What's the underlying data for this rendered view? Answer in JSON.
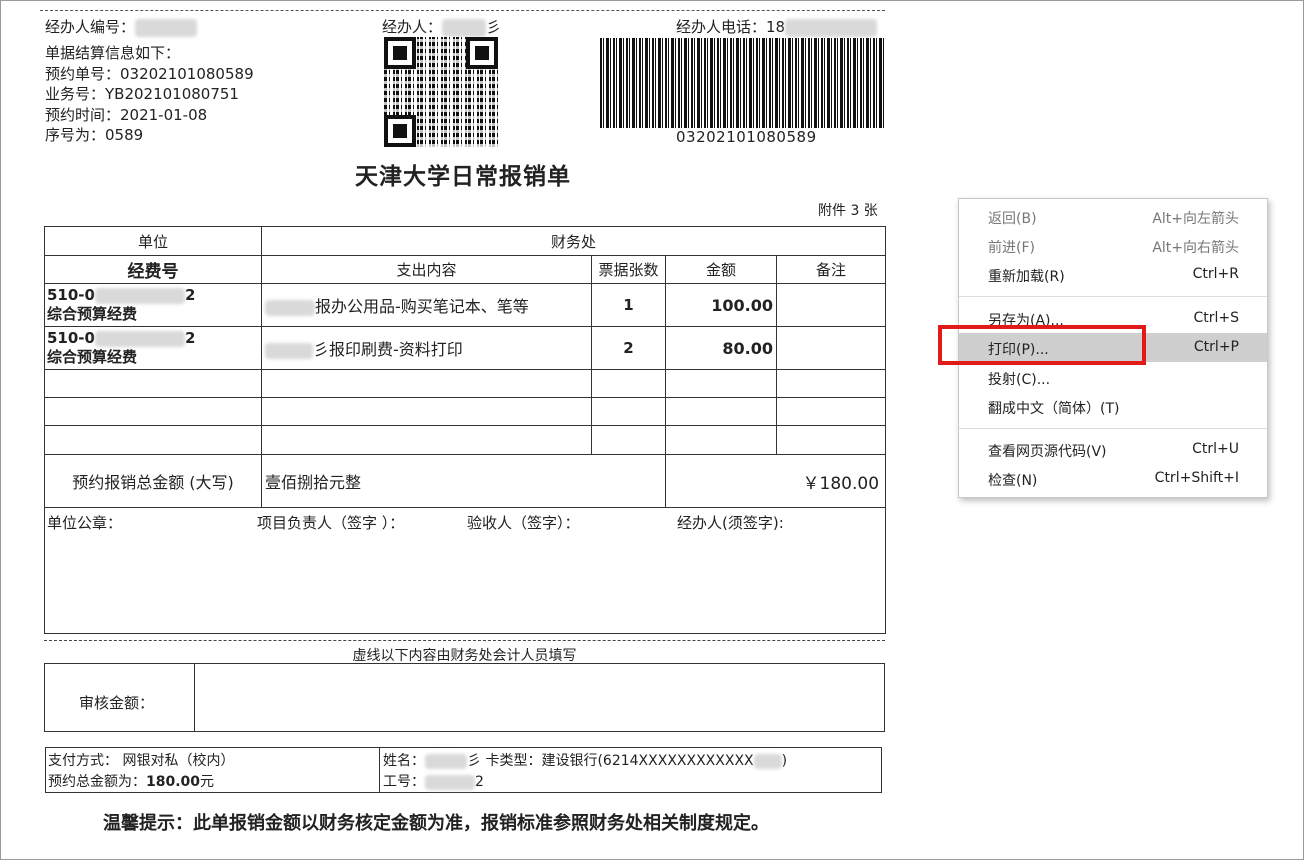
{
  "header": {
    "agent_no_label": "经办人编号：",
    "agent_label": "经办人：",
    "agent_name_suffix": "彡",
    "agent_phone_label": "经办人电话：",
    "agent_phone_prefix": "18"
  },
  "settlement": {
    "intro": "单据结算信息如下：",
    "booking_no": "预约单号：03202101080589",
    "business_no": "业务号：YB202101080751",
    "booking_time": "预约时间：2021-01-08",
    "serial_no": "序号为：0589"
  },
  "barcode_text": "03202101080589",
  "title": "天津大学日常报销单",
  "attachments": "附件 3 张",
  "table": {
    "h_unit": "单位",
    "h_finance": "财务处",
    "h_fund_no": "经费号",
    "h_content": "支出内容",
    "h_count": "票据张数",
    "h_amount": "金额",
    "h_remark": "备注",
    "rows": [
      {
        "fund_prefix": "510-0",
        "fund_suffix": "2",
        "fund_name": "综合预算经费",
        "content": "报办公用品-购买笔记本、笔等",
        "count": "1",
        "amount": "100.00",
        "remark": ""
      },
      {
        "fund_prefix": "510-0",
        "fund_suffix": "2",
        "fund_name": "综合预算经费",
        "content": "彡报印刷费-资料打印",
        "count": "2",
        "amount": "80.00",
        "remark": ""
      }
    ],
    "total_label": "预约报销总金额 (大写)",
    "total_upper": "壹佰捌拾元整",
    "total_amount": "￥180.00",
    "sig_unit_seal": "单位公章：",
    "sig_project_lead": "项目负责人（签字 ）：",
    "sig_acceptor": "验收人（签字）：",
    "sig_agent": "经办人(须签字):"
  },
  "dashed_note": "虚线以下内容由财务处会计人员填写",
  "audit_label": "审核金额：",
  "payment": {
    "method": "支付方式：  网银对私（校内）",
    "total_label": "预约总金额为：",
    "total_value": "180.00",
    "total_unit": "元",
    "name_label": "姓名：",
    "name_suffix": "彡",
    "card_type": " 卡类型：建设银行(6214XXXXXXXXXXXX",
    "card_end": ")",
    "staff_label": "工号：",
    "staff_suffix": "2"
  },
  "tip": "温馨提示：此单报销金额以财务核定金额为准，报销标准参照财务处相关制度规定。",
  "context_menu": {
    "items": [
      {
        "label": "返回(B)",
        "shortcut": "Alt+向左箭头"
      },
      {
        "label": "前进(F)",
        "shortcut": "Alt+向右箭头"
      },
      {
        "label": "重新加载(R)",
        "shortcut": "Ctrl+R"
      },
      {
        "label": "另存为(A)...",
        "shortcut": "Ctrl+S"
      },
      {
        "label": "打印(P)...",
        "shortcut": "Ctrl+P"
      },
      {
        "label": "投射(C)...",
        "shortcut": ""
      },
      {
        "label": "翻成中文（简体）(T)",
        "shortcut": ""
      },
      {
        "label": "查看网页源代码(V)",
        "shortcut": "Ctrl+U"
      },
      {
        "label": "检查(N)",
        "shortcut": "Ctrl+Shift+I"
      }
    ],
    "highlight_color": "#e21a1a"
  }
}
